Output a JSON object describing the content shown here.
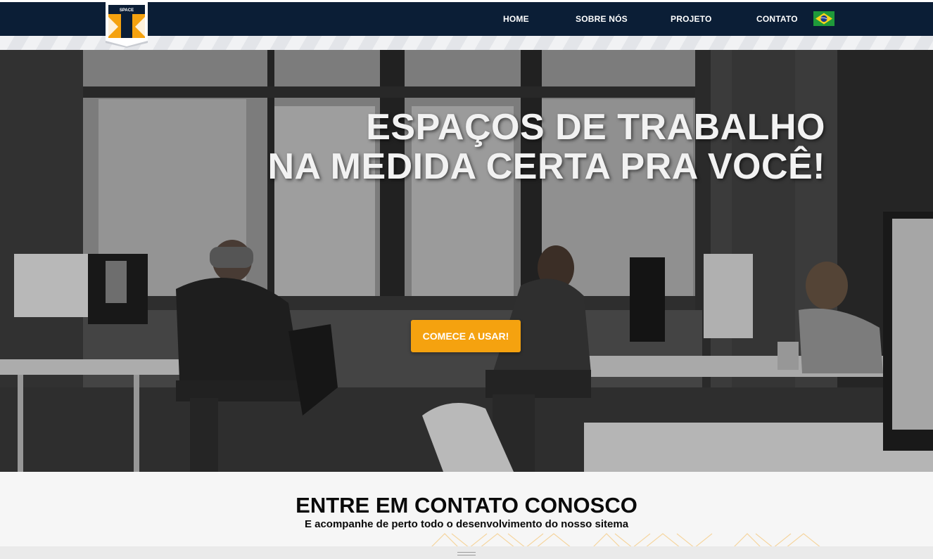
{
  "nav": {
    "logo_text": "SPACE",
    "items": [
      {
        "label": "HOME"
      },
      {
        "label": "SOBRE NÓS"
      },
      {
        "label": "PROJETO"
      },
      {
        "label": "CONTATO"
      }
    ],
    "language_flag": "brazil-flag-icon"
  },
  "hero": {
    "title_line1": "ESPAÇOS DE TRABALHO",
    "title_line2": "NA MEDIDA CERTA PRA VOCÊ!",
    "cta_label": "COMECE A USAR!"
  },
  "contact": {
    "title": "ENTRE EM CONTATO CONOSCO",
    "subtitle": "E acompanhe de perto todo o desenvolvimento do nosso sitema"
  },
  "colors": {
    "navbar": "#0b1e36",
    "accent": "#f5a20f",
    "hero_text": "#f2f2f2"
  }
}
